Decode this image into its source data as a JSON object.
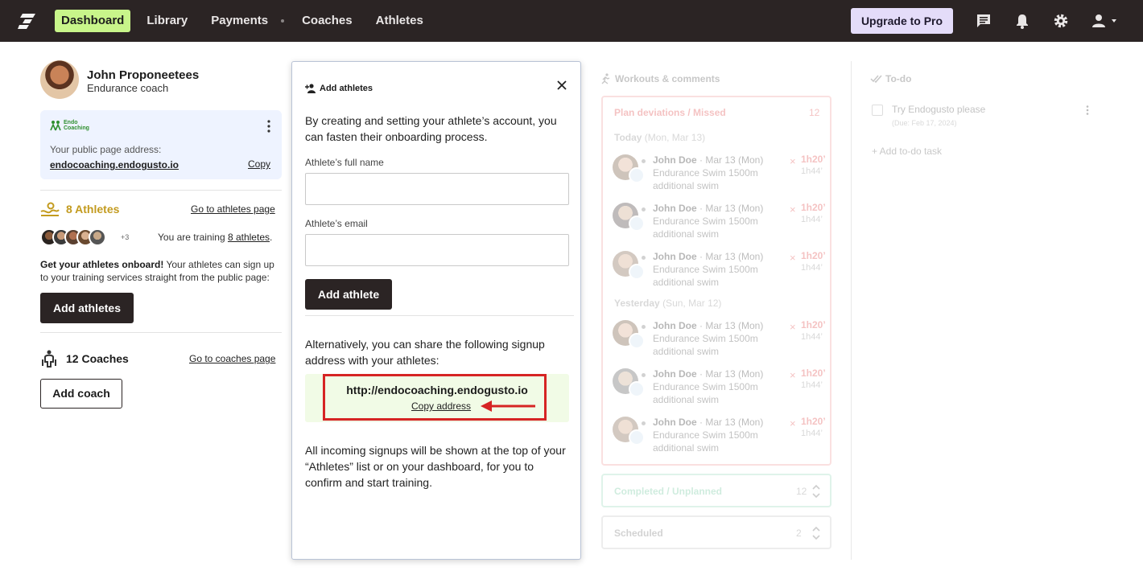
{
  "nav": {
    "items": [
      "Dashboard",
      "Library",
      "Payments",
      "Coaches",
      "Athletes"
    ],
    "upgrade_label": "Upgrade to Pro"
  },
  "profile": {
    "name": "John Proponeetees",
    "role": "Endurance coach"
  },
  "public_page": {
    "logo_text_1": "Endo",
    "logo_text_2": "Coaching",
    "label": "Your public page address:",
    "url": "endocoaching.endogusto.io",
    "copy_label": "Copy"
  },
  "athletes": {
    "count_label": "8 Athletes",
    "go_link": "Go to athletes page",
    "more_count": "+3",
    "training_prefix": "You are training ",
    "training_link": "8 athletes",
    "training_suffix": ".",
    "onboard_bold": "Get your athletes onboard!",
    "onboard_text": " Your athletes can sign up to your training services straight from the public page:",
    "add_button": "Add athletes"
  },
  "coaches": {
    "count_label": "12 Coaches",
    "go_link": "Go to coaches page",
    "add_button": "Add coach"
  },
  "modal": {
    "title": "Add athletes",
    "intro": "By creating and setting your athlete’s account, you can fasten their onboarding process.",
    "name_label": "Athlete’s full name",
    "name_value": "",
    "email_label": "Athlete’s email",
    "email_value": "",
    "submit": "Add athlete",
    "alternative": "Alternatively, you can share the following signup address with your athletes:",
    "signup_url": "http://endocoaching.endogusto.io",
    "copy_address": "Copy address",
    "incoming": "All incoming signups will be shown at the top of your “Athletes” list or on your dashboard, for you to confirm and start training."
  },
  "workouts": {
    "header": "Workouts & comments",
    "deviations_title": "Plan deviations / Missed",
    "deviations_count": "12",
    "days": [
      {
        "label": "Today",
        "date": "(Mon, Mar 13)"
      },
      {
        "label": "Yesterday",
        "date": "(Sun, Mar 12)"
      }
    ],
    "items": [
      {
        "name": "John Doe",
        "date": " · Mar 13 (Mon)",
        "line1": "Endurance Swim 1500m",
        "line2": "additional swim",
        "time": "1h20’",
        "time2": "1h44’"
      },
      {
        "name": "John Doe",
        "date": " · Mar 13 (Mon)",
        "line1": "Endurance Swim 1500m",
        "line2": "additional swim",
        "time": "1h20’",
        "time2": "1h44’"
      },
      {
        "name": "John Doe",
        "date": " · Mar 13 (Mon)",
        "line1": "Endurance Swim 1500m",
        "line2": "additional swim",
        "time": "1h20’",
        "time2": "1h44’"
      },
      {
        "name": "John Doe",
        "date": " · Mar 13 (Mon)",
        "line1": "Endurance Swim 1500m",
        "line2": "additional swim",
        "time": "1h20’",
        "time2": "1h44’"
      },
      {
        "name": "John Doe",
        "date": " · Mar 13 (Mon)",
        "line1": "Endurance Swim 1500m",
        "line2": "additional swim",
        "time": "1h20’",
        "time2": "1h44’"
      },
      {
        "name": "John Doe",
        "date": " · Mar 13 (Mon)",
        "line1": "Endurance Swim 1500m",
        "line2": "additional swim",
        "time": "1h20’",
        "time2": "1h44’"
      }
    ],
    "completed_title": "Completed / Unplanned",
    "completed_count": "12",
    "scheduled_title": "Scheduled",
    "scheduled_count": "2",
    "miss_symbol": "×"
  },
  "todo": {
    "header": "To-do",
    "item_text": "Try Endogusto please",
    "item_due": "(Due: Feb 17, 2024)",
    "add_label": "+ Add to-do task"
  },
  "colors": {
    "nav_bg": "#2b2424",
    "nav_active": "#c8f58a",
    "upgrade_bg": "#e4dcf9",
    "athletes_accent": "#c39b1f",
    "deviation_red": "#e04545",
    "highlight_red": "#d62424"
  }
}
